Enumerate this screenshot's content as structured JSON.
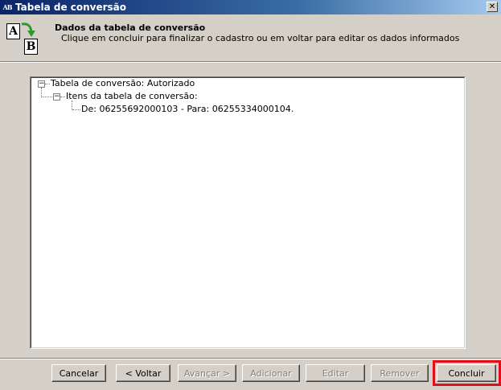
{
  "window": {
    "title": "Tabela de conversão",
    "icon_glyph": "AB",
    "close_glyph": "✕"
  },
  "header": {
    "title": "Dados da tabela de conversão",
    "description": "Clique em concluir para finalizar o cadastro ou em voltar para editar os dados informados",
    "icon": {
      "card_a": "A",
      "card_b": "B",
      "arrow_color": "#2e9a2e"
    }
  },
  "tree": {
    "root": {
      "label": "Tabela de conversão: Autorizado",
      "expander": "−"
    },
    "child": {
      "label": "Itens da tabela de conversão:",
      "expander": "−"
    },
    "leaf": {
      "label": "De: 06255692000103 - Para: 06255334000104."
    }
  },
  "buttons": {
    "cancel": "Cancelar",
    "back": "< Voltar",
    "next": "Avançar >",
    "add": "Adicionar",
    "edit": "Editar",
    "remove": "Remover",
    "finish": "Concluir"
  },
  "colors": {
    "highlight": "#e0101a",
    "title_bar": "#0a246a"
  }
}
